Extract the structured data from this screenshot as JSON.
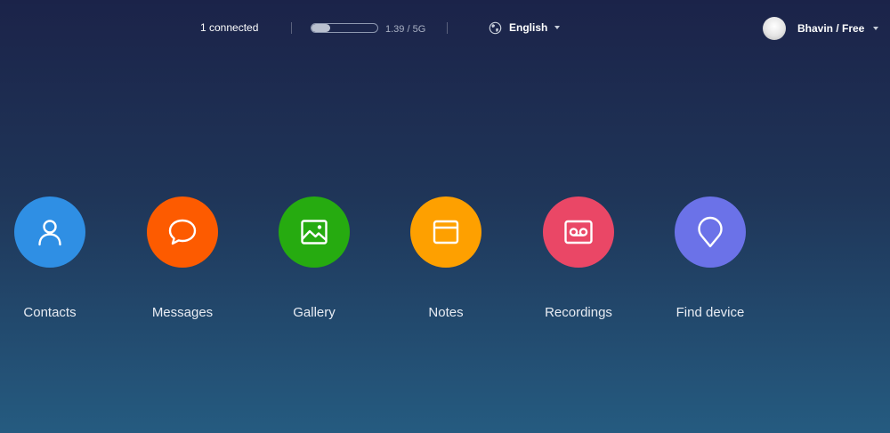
{
  "topbar": {
    "connected_text": "1 connected",
    "storage": {
      "used_fraction": 0.28,
      "text": "1.39 / 5G"
    },
    "language": {
      "icon": "globe-icon",
      "label": "English"
    },
    "user": {
      "label": "Bhavin / Free"
    }
  },
  "apps": [
    {
      "label": "Contacts",
      "icon": "person-icon",
      "color": "#2f8fe4"
    },
    {
      "label": "Messages",
      "icon": "chat-bubble-icon",
      "color": "#fd5b00"
    },
    {
      "label": "Gallery",
      "icon": "image-icon",
      "color": "#26ab10"
    },
    {
      "label": "Notes",
      "icon": "note-icon",
      "color": "#fea000"
    },
    {
      "label": "Recordings",
      "icon": "cassette-icon",
      "color": "#ea4766"
    },
    {
      "label": "Find device",
      "icon": "location-pin-icon",
      "color": "#6b72e8"
    }
  ]
}
